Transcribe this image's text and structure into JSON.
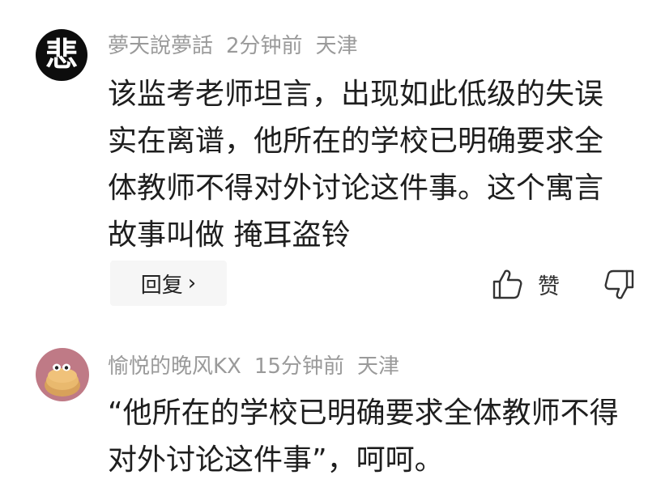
{
  "comments": [
    {
      "username": "夢天說夢話",
      "time": "2分钟前",
      "location": "天津",
      "avatar_char": "悲",
      "text": "该监考老师坦言，出现如此低级的失误实在离谱，他所在的学校已明确要求全体教师不得对外讨论这件事。这个寓言故事叫做 掩耳盗铃",
      "reply_label": "回复",
      "reply_chevron": "›",
      "like_label": "赞"
    },
    {
      "username": "愉悦的晚风KX",
      "time": "15分钟前",
      "location": "天津",
      "text": "“他所在的学校已明确要求全体教师不得对外讨论这件事”，呵呵。"
    }
  ],
  "icons": {
    "like": "thumbs-up-icon",
    "dislike": "thumbs-down-icon"
  },
  "colors": {
    "meta_text": "#9a9a9a",
    "body_text": "#1e1e1e",
    "reply_bg": "#f6f6f6"
  }
}
